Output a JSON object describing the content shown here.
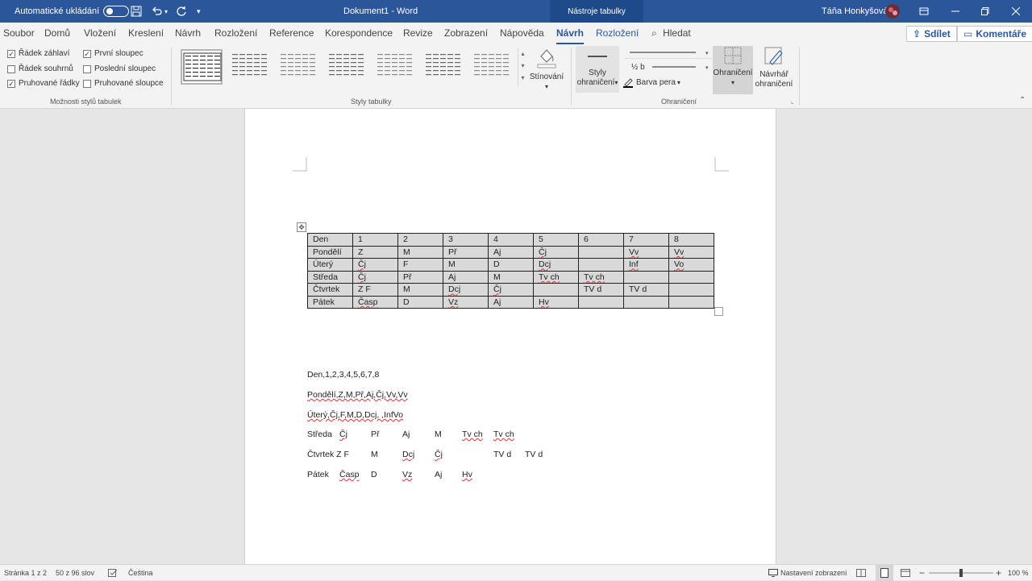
{
  "titlebar": {
    "autosave_label": "Automatické ukládání",
    "doc_title": "Dokument1 - Word",
    "context_tab": "Nástroje tabulky",
    "user_name": "Táňa Honkyšová"
  },
  "tabs": [
    "Soubor",
    "Domů",
    "Vložení",
    "Kreslení",
    "Návrh",
    "Rozložení",
    "Reference",
    "Korespondence",
    "Revize",
    "Zobrazení",
    "Nápověda",
    "Návrh",
    "Rozložení"
  ],
  "search_label": "Hledat",
  "share_label": "Sdílet",
  "comments_label": "Komentáře",
  "ribbon": {
    "options": [
      {
        "label": "Řádek záhlaví",
        "checked": true
      },
      {
        "label": "První sloupec",
        "checked": true
      },
      {
        "label": "Řádek souhrnů",
        "checked": false
      },
      {
        "label": "Poslední sloupec",
        "checked": false
      },
      {
        "label": "Pruhované řádky",
        "checked": true
      },
      {
        "label": "Pruhované sloupce",
        "checked": false
      }
    ],
    "options_group": "Možnosti stylů tabulek",
    "styles_group": "Styly tabulky",
    "shading_label": "Stínování",
    "border_styles_label1": "Styly",
    "border_styles_label2": "ohraničení",
    "line_weight": "½ b",
    "pen_color_label": "Barva pera",
    "borders_label": "Ohraničení",
    "painter_label1": "Návrhář",
    "painter_label2": "ohraničení",
    "borders_group": "Ohraničení"
  },
  "table": [
    [
      "Den",
      "1",
      "2",
      "3",
      "4",
      "5",
      "6",
      "7",
      "8"
    ],
    [
      "Pondělí",
      "Z",
      "M",
      "Př",
      "Aj",
      "Čj",
      "",
      "Vv",
      "Vv"
    ],
    [
      "Úterý",
      "Čj",
      "F",
      "M",
      "D",
      "Dcj",
      "",
      "Inf",
      "Vo"
    ],
    [
      "Středa",
      "Čj",
      "Př",
      "Aj",
      "M",
      "Tv ch",
      "Tv ch",
      "",
      ""
    ],
    [
      "Čtvrtek",
      "Z F",
      "M",
      "Dcj",
      "Čj",
      "",
      "TV d",
      "TV d",
      ""
    ],
    [
      "Pátek",
      "Časp",
      "D",
      "Vz",
      "Aj",
      "Hv",
      "",
      "",
      ""
    ]
  ],
  "text_lines": {
    "line1": "Den,1,2,3,4,5,6,7,8",
    "line2": "Pondělí,Z,M,Př,Aj,Čj,Vv,Vv",
    "line3": "Úterý,Čj,F,M,D,Dcj, ,InfVo",
    "line4": [
      "Středa",
      "Čj",
      "Př",
      "Aj",
      "M",
      "Tv ch",
      "Tv ch"
    ],
    "line5": [
      "Čtvrtek Z F",
      "M",
      "Dcj",
      "Čj",
      "TV d",
      "TV d"
    ],
    "line6": [
      "Pátek",
      "Časp",
      "D",
      "Vz",
      "Aj",
      "Hv"
    ]
  },
  "status": {
    "page": "Stránka 1 z 2",
    "words": "50 z 96 slov",
    "language": "Čeština",
    "display_settings": "Nastavení zobrazení",
    "zoom": "100 %"
  },
  "colors": {
    "word_blue": "#2b579a",
    "ribbon_bg": "#f3f3f3",
    "table_shading": "#d9d9d9"
  }
}
